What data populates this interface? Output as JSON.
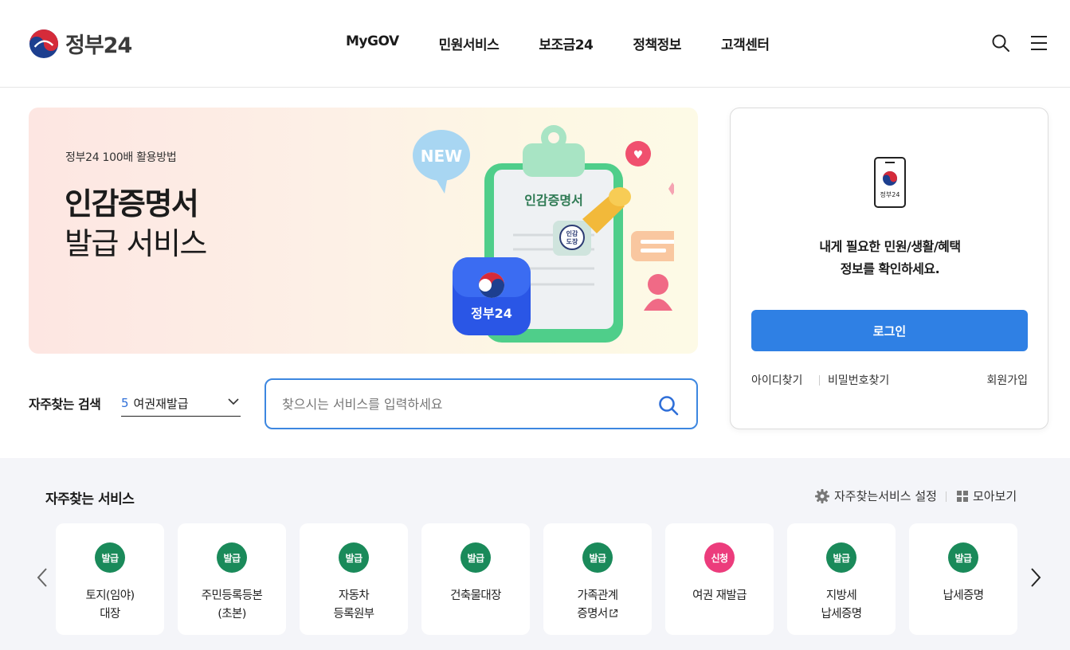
{
  "header": {
    "logo_text": "정부24",
    "nav": [
      "MyGOV",
      "민원서비스",
      "보조금24",
      "정책정보",
      "고객센터"
    ]
  },
  "banner": {
    "subtitle": "정부24 100배 활용방법",
    "title_line1": "인감증명서",
    "title_line2": "발급 서비스",
    "art": {
      "new_bubble": "NEW",
      "clipboard_title": "인감증명서",
      "stamp_text": "인감\n도장",
      "app_icon_text": "정부24"
    }
  },
  "login": {
    "phone_label": "정부24",
    "message_line1": "내게 필요한 민원/생활/혜택",
    "message_line2": "정보를 확인하세요.",
    "login_button": "로그인",
    "find_id": "아이디찾기",
    "find_password": "비밀번호찾기",
    "signup": "회원가입"
  },
  "frequent_search": {
    "label": "자주찾는 검색",
    "selected_rank": "5",
    "selected_text": "여권재발급"
  },
  "search": {
    "placeholder": "찾으시는 서비스를 입력하세요"
  },
  "services": {
    "title": "자주찾는 서비스",
    "settings_label": "자주찾는서비스 설정",
    "view_all_label": "모아보기",
    "items": [
      {
        "badge": "발급",
        "label": "토지(임야)\n대장",
        "badge_color": "#1a8a5a"
      },
      {
        "badge": "발급",
        "label": "주민등록등본\n(초본)",
        "badge_color": "#1a8a5a"
      },
      {
        "badge": "발급",
        "label": "자동차\n등록원부",
        "badge_color": "#1a8a5a"
      },
      {
        "badge": "발급",
        "label": "건축물대장",
        "badge_color": "#1a8a5a"
      },
      {
        "badge": "발급",
        "label": "가족관계\n증명서",
        "badge_color": "#1a8a5a",
        "external": true
      },
      {
        "badge": "신청",
        "label": "여권 재발급",
        "badge_color": "#ec3c7c"
      },
      {
        "badge": "발급",
        "label": "지방세\n납세증명",
        "badge_color": "#1a8a5a"
      },
      {
        "badge": "발급",
        "label": "납세증명",
        "badge_color": "#1a8a5a"
      }
    ]
  },
  "colors": {
    "primary_blue": "#2f80e4",
    "issue_green": "#1a8a5a",
    "apply_pink": "#ec3c7c",
    "section_bg": "#f4f5f9"
  }
}
